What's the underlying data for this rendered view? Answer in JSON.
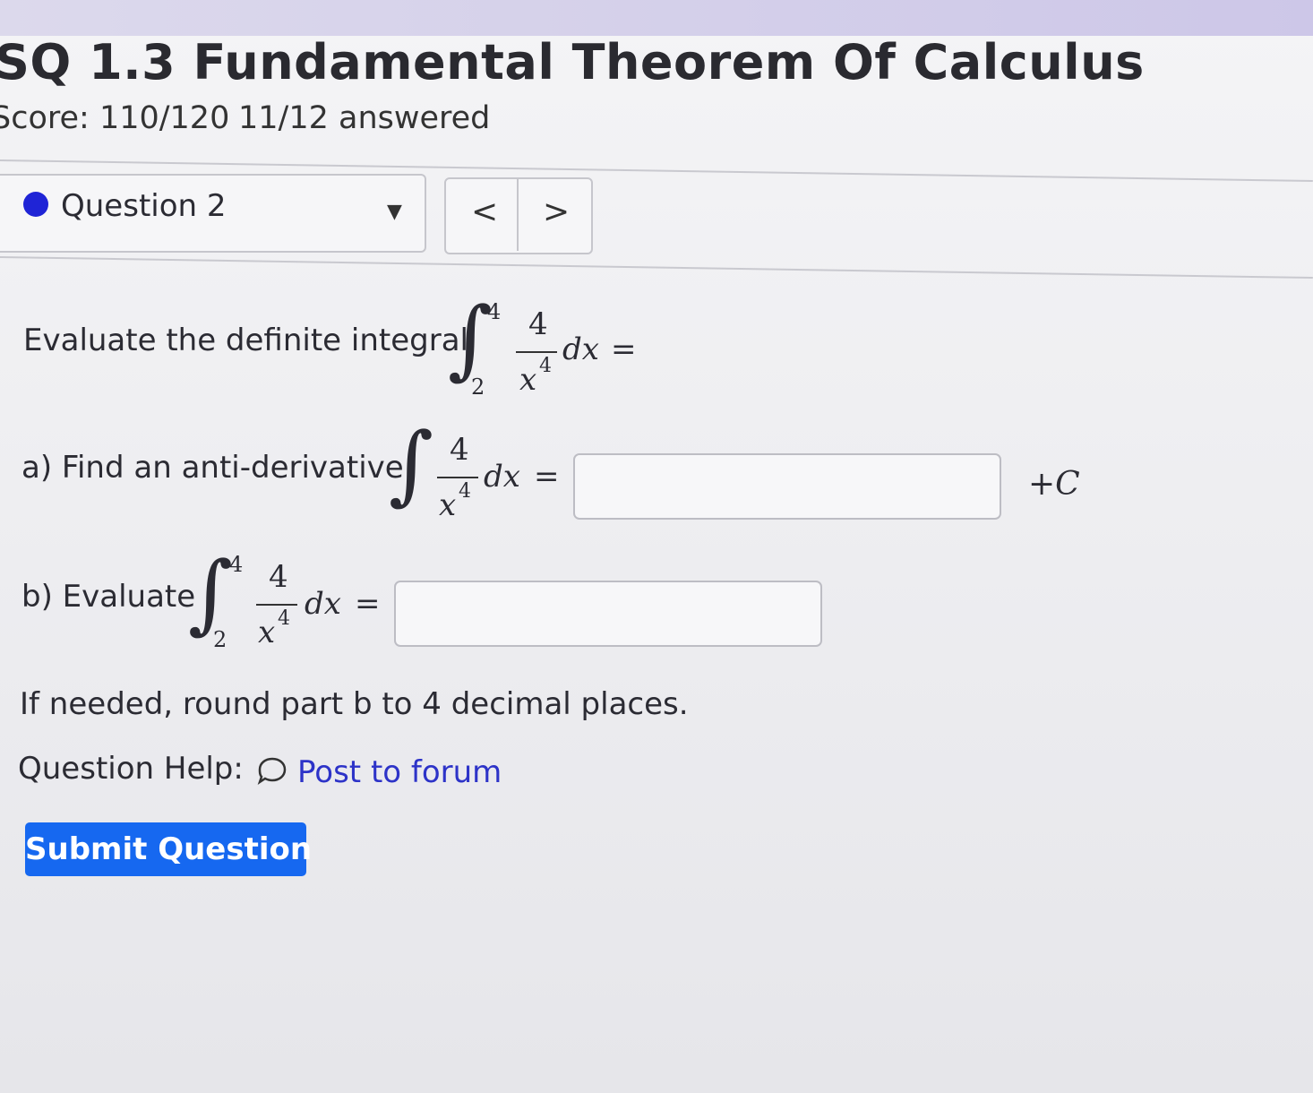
{
  "header": {
    "title": "SQ 1.3 Fundamental Theorem Of Calculus",
    "score": "Score: 110/120",
    "answered": "11/12 answered"
  },
  "question_nav": {
    "label": "Question 2",
    "prev": "<",
    "next": ">",
    "status_color": "#1f24d6"
  },
  "question": {
    "prompt": "Evaluate the definite integral",
    "integral": {
      "lower": "2",
      "upper": "4",
      "numerator": "4",
      "denominator": "x",
      "exponent": "4",
      "differential": "dx",
      "equals": "="
    },
    "part_a_label": "a) Find an anti-derivative",
    "part_a_suffix": "+C",
    "part_b_label": "b) Evaluate",
    "rounding_note": "If needed, round part b to 4 decimal places."
  },
  "help": {
    "label": "Question Help:",
    "link": "Post to forum"
  },
  "submit": {
    "label": "Submit Question",
    "color": "#1668f0"
  }
}
